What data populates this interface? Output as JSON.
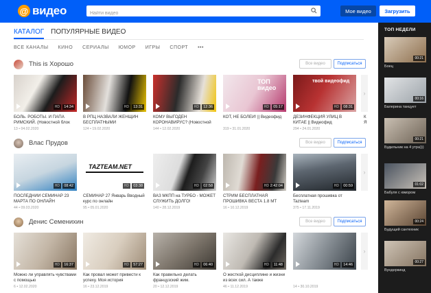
{
  "brand": {
    "logo_symbol": "@",
    "logo_text": "видео",
    "accent": "#005ff9"
  },
  "search": {
    "placeholder": "Найти видео"
  },
  "header": {
    "my_video": "Мое видео",
    "upload": "Загрузить"
  },
  "tabs": {
    "catalog": "КАТАЛОГ",
    "popular": "ПОПУЛЯРНЫЕ ВИДЕО"
  },
  "subnav": [
    "ВСЕ КАНАЛЫ",
    "КИНО",
    "СЕРИАЛЫ",
    "ЮМОР",
    "ИГРЫ",
    "СПОРТ",
    "•••"
  ],
  "channel_buttons": {
    "all": "Все видео",
    "subscribe": "Подписаться"
  },
  "channels": [
    {
      "name": "This is Хорошо",
      "videos": [
        {
          "title": "БОЛЬ. РОБОТЫ. И ПАПА РИМСКИЙ. (Новостной блок",
          "meta": "13 • 04.02.2020",
          "duration": "14:34",
          "hd": "HD"
        },
        {
          "title": "В РПЦ НАЗВАЛИ ЖЕНЩИН БЕСПЛАТНЫМИ",
          "meta": "124 • 19.02.2020",
          "duration": "13:31",
          "hd": "HD"
        },
        {
          "title": "КОМУ ВЫГОДЕН КОРОНАВИРУС? (Новостной",
          "meta": "144 • 12.02.2020",
          "duration": "12:36",
          "hd": "HD"
        },
        {
          "title": "КОТ, НЕ БОЛЕЙ! || Видеофид",
          "meta": "319 • 31.01.2020",
          "duration": "05:17",
          "hd": "HD"
        },
        {
          "title": "ДЕЗИНФЕКЦИЯ УЛИЦ В КИТАЕ || Видеофид",
          "meta": "294 • 24.01.2020",
          "duration": "08:31",
          "hd": "HD"
        }
      ],
      "overflow_title": "К Я"
    },
    {
      "name": "Влас Прудов",
      "videos": [
        {
          "title": "ПОСЛЕДНИЙ СЕМИНАР 23 МАРТА ПО ОНЛАЙН",
          "meta": "44 • 09.03.2020",
          "duration": "08:42",
          "hd": "HD"
        },
        {
          "title": "СЕМИНАР 27 Январь Вводный курс по онлайн",
          "meta": "95 • 05.01.2020",
          "duration": "03:38",
          "hd": "HD"
        },
        {
          "title": "ВАЗ МКПП на ТУРБО - МОЖЕТ СЛУЖИТЬ ДОЛГО!",
          "meta": "140 • 28.12.2019",
          "duration": "02:58",
          "hd": "HD"
        },
        {
          "title": "СТРИМ БЕСПЛАТНАЯ ПРОШИВКА ВЕСТА 1.8 МТ",
          "meta": "16 • 10.12.2019",
          "duration": "2:42:04",
          "hd": "HD"
        },
        {
          "title": "Бесплатная прошивка от Tazteam",
          "meta": "375 • 17.11.2019",
          "duration": "00:59",
          "hd": "HD"
        }
      ],
      "thumb_caption": "TAZTEAM.NET"
    },
    {
      "name": "Денис Семенихин",
      "videos": [
        {
          "title": "Можно ли управлять чувствами с помощью",
          "meta": "6 • 12.02.2020",
          "duration": "16:37",
          "hd": "HD"
        },
        {
          "title": "Как провал может привести к успеху. Моя история",
          "meta": "16 • 23.12.2019",
          "duration": "57:27",
          "hd": "HD"
        },
        {
          "title": "Как правильно делать французский жим.",
          "meta": "20 • 12.12.2019",
          "duration": "06:40",
          "hd": "HD"
        },
        {
          "title": "О жесткой дисциплине и жизни из всех сил. А также",
          "meta": "46 • 11.12.2019",
          "duration": "11:48",
          "hd": "HD"
        },
        {
          "title": "",
          "meta": "14 • 30.10.2019",
          "duration": "14:46",
          "hd": "HD"
        }
      ]
    }
  ],
  "thumb_texts": {
    "video4": "ТОП видео",
    "video5": "твой видеофид"
  },
  "sidebar": {
    "title": "ТОП НЕДЕЛИ",
    "items": [
      {
        "label": "Боец",
        "duration": "00:21"
      },
      {
        "label": "Балерина танцует",
        "duration": "00:16"
      },
      {
        "label": "Будильник на 4 утра)))",
        "duration": "00:21"
      },
      {
        "label": "Бабуля с юмором",
        "duration": "01:02"
      },
      {
        "label": "Будущий сантехник",
        "duration": "00:24"
      },
      {
        "label": "Вундеркинд",
        "duration": "00:27"
      }
    ]
  }
}
